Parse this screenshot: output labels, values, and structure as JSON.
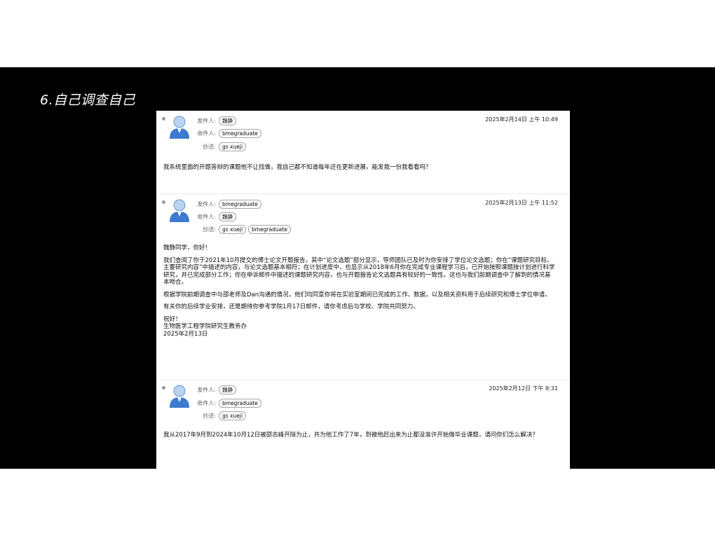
{
  "slide": {
    "title": "6.自己调查自己"
  },
  "colors": {
    "background": "#000000",
    "link": "#2f5eb0",
    "chip_border": "#a8a8a8"
  },
  "icons": {
    "avatar": "person-avatar-icon"
  },
  "labels": {
    "from": "发件人:",
    "to": "收件人:",
    "cc": "抄送:"
  },
  "emails": [
    {
      "date": "2025年2月14日 上午 10:49",
      "from": [
        "魏静"
      ],
      "to": [
        "bmegraduate"
      ],
      "cc": [
        "gs xueji"
      ],
      "body": "我系统里面的开题答辩的课题他不让找做，我自己都不知道每年还在更新进展，能发我一份我看看吗？"
    },
    {
      "date": "2025年2月13日 上午 11:52",
      "from": [
        "bmegraduate"
      ],
      "to": [
        "魏静"
      ],
      "cc": [
        "gs xueji",
        "bmegraduate"
      ],
      "greeting": "魏静同学，你好！",
      "p1": "我们查阅了你于2021年10月提交的博士论文开题报告，其中“论文选题”部分显示，导师团队已及时为你安排了学位论文选题；你在“课题研究目标、主要研究内容”中描述的内容，与论文选题基本相符；在计划进度中，也显示从2018年6月你在完成专业课程学习后，已开始按照课题按计划进行科学研究，并已完成部分工作；你在申诉邮件中描述的课题研究内容，也与开题报告论文选题具有较好的一致性。这也与我们前期调查中了解到的情况基本吻合。",
      "p2": "根据学院前期调查中与邵老师及Dan沟通的情况，他们均同意你将在实验室期间已完成的工作、数据，以及相关资料用于后续研究和博士学位申请。",
      "p3": "有关你的后续学业安排，还是期待你参考学院1月17日邮件，请你考虑后与学校、学院共同努力。",
      "sign": "祝好！",
      "office": "生物医学工程学院研究生教务办",
      "sign_date": "2025年2月13日"
    },
    {
      "date": "2025年2月12日 下午 8:31",
      "from": [
        "魏静"
      ],
      "to": [
        "bmegraduate"
      ],
      "cc": [
        "gs xueji"
      ],
      "body": "我从2017年9月到2024年10月12日被邵志峰开除为止，共为他工作了7年，到被他赶出来为止都没准许开始做毕业课题，请问你们怎么解决？"
    }
  ]
}
